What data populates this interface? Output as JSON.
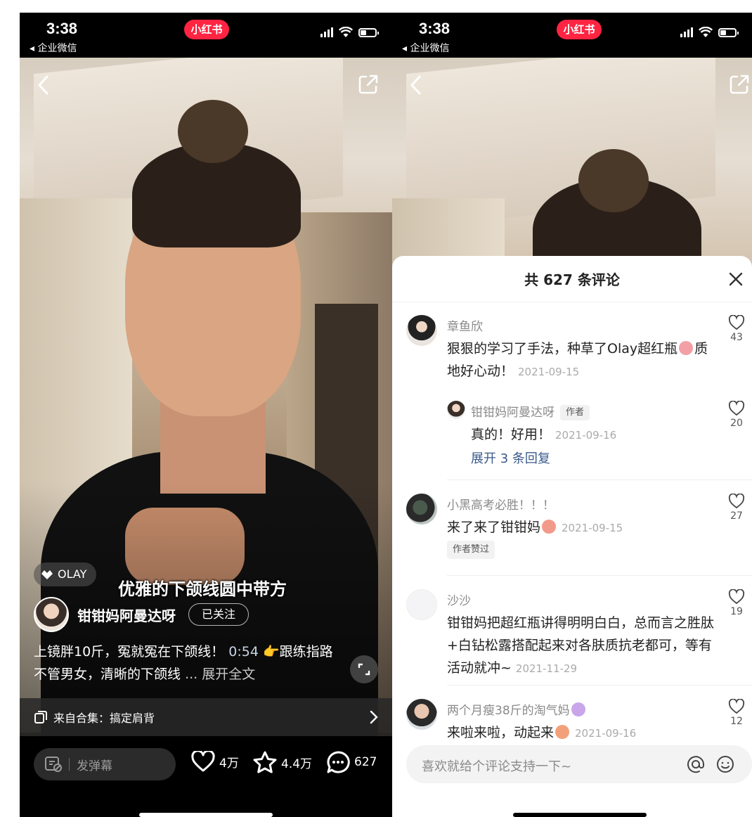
{
  "status_bar": {
    "time": "3:38",
    "sub_app": "◂ 企业微信",
    "app_badge": "小红书"
  },
  "video_left": {
    "brand_tag": "OLAY",
    "subtitle": "优雅的下颌线圆中带方",
    "author_name": "钳钳妈阿曼达呀",
    "follow_label": "已关注",
    "desc_text": "上镜胖10斤，冤就冤在下颌线！",
    "desc_timestamp": "0:54",
    "desc_pointer": "👉",
    "desc_text2": "跟练指路 不管男女，清晰的下颌线",
    "desc_more": "... 展开全文",
    "collection_label": "来自合集：搞定肩背",
    "danmu_placeholder": "发弹幕",
    "like_count": "4万",
    "collect_count": "4.4万",
    "comment_count": "627"
  },
  "comments_panel": {
    "title": "共 627 条评论",
    "input_placeholder": "喜欢就给个评论支持一下~",
    "comments": [
      {
        "name": "章鱼欣",
        "text": "狠狠的学习了手法，种草了Olay超红瓶",
        "text_after_emoji": "质地好心动！",
        "date": "2021-09-15",
        "likes": "43"
      },
      {
        "name": "钳钳妈阿曼达呀",
        "tag": "作者",
        "text": "真的！好用！",
        "date": "2021-09-16",
        "likes": "20"
      },
      {
        "expand_label": "展开 3 条回复"
      },
      {
        "name": "小黑高考必胜！！！",
        "text": "来了来了钳钳妈",
        "date": "2021-09-15",
        "likes": "27",
        "chip": "作者赞过"
      },
      {
        "name": "沙沙",
        "text": "钳钳妈把超红瓶讲得明明白白，总而言之胜肽+白钻松露搭配起来对各肤质抗老都可，等有活动就冲~",
        "date": "2021-11-29",
        "likes": "19"
      },
      {
        "name": "两个月瘦38斤的淘气妈",
        "text": "来啦来啦，动起来",
        "date": "2021-09-16",
        "likes": "12"
      }
    ]
  },
  "colors": {
    "brand_red": "#ff2442",
    "link_blue": "#3a5a8c",
    "timestamp_blue": "#c8d4e6"
  },
  "icons": [
    "back-icon",
    "share-icon",
    "olay-logo-icon",
    "fullscreen-icon",
    "collection-icon",
    "chevron-right-icon",
    "danmu-icon",
    "heart-icon",
    "star-icon",
    "comment-icon",
    "close-icon",
    "at-icon",
    "smile-icon"
  ]
}
